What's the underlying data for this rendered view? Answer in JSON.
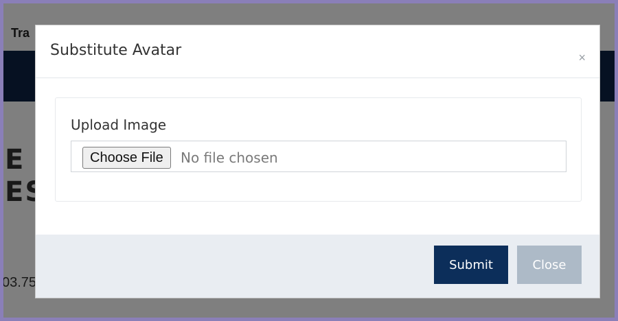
{
  "background": {
    "title_fragment": "Tra",
    "big_text_line1": "E",
    "big_text_line2": "ES",
    "number_fragment": "03.75"
  },
  "modal": {
    "title": "Substitute Avatar",
    "close_icon": "×",
    "upload_label": "Upload Image",
    "choose_file_label": "Choose File",
    "file_status": "No file chosen",
    "submit_label": "Submit",
    "close_label": "Close"
  },
  "colors": {
    "submit": "#0c2e5a",
    "close": "#adbac7",
    "footer": "#e9edf2",
    "navbar": "#0d2344"
  },
  "icons": {
    "close": "close-icon"
  }
}
